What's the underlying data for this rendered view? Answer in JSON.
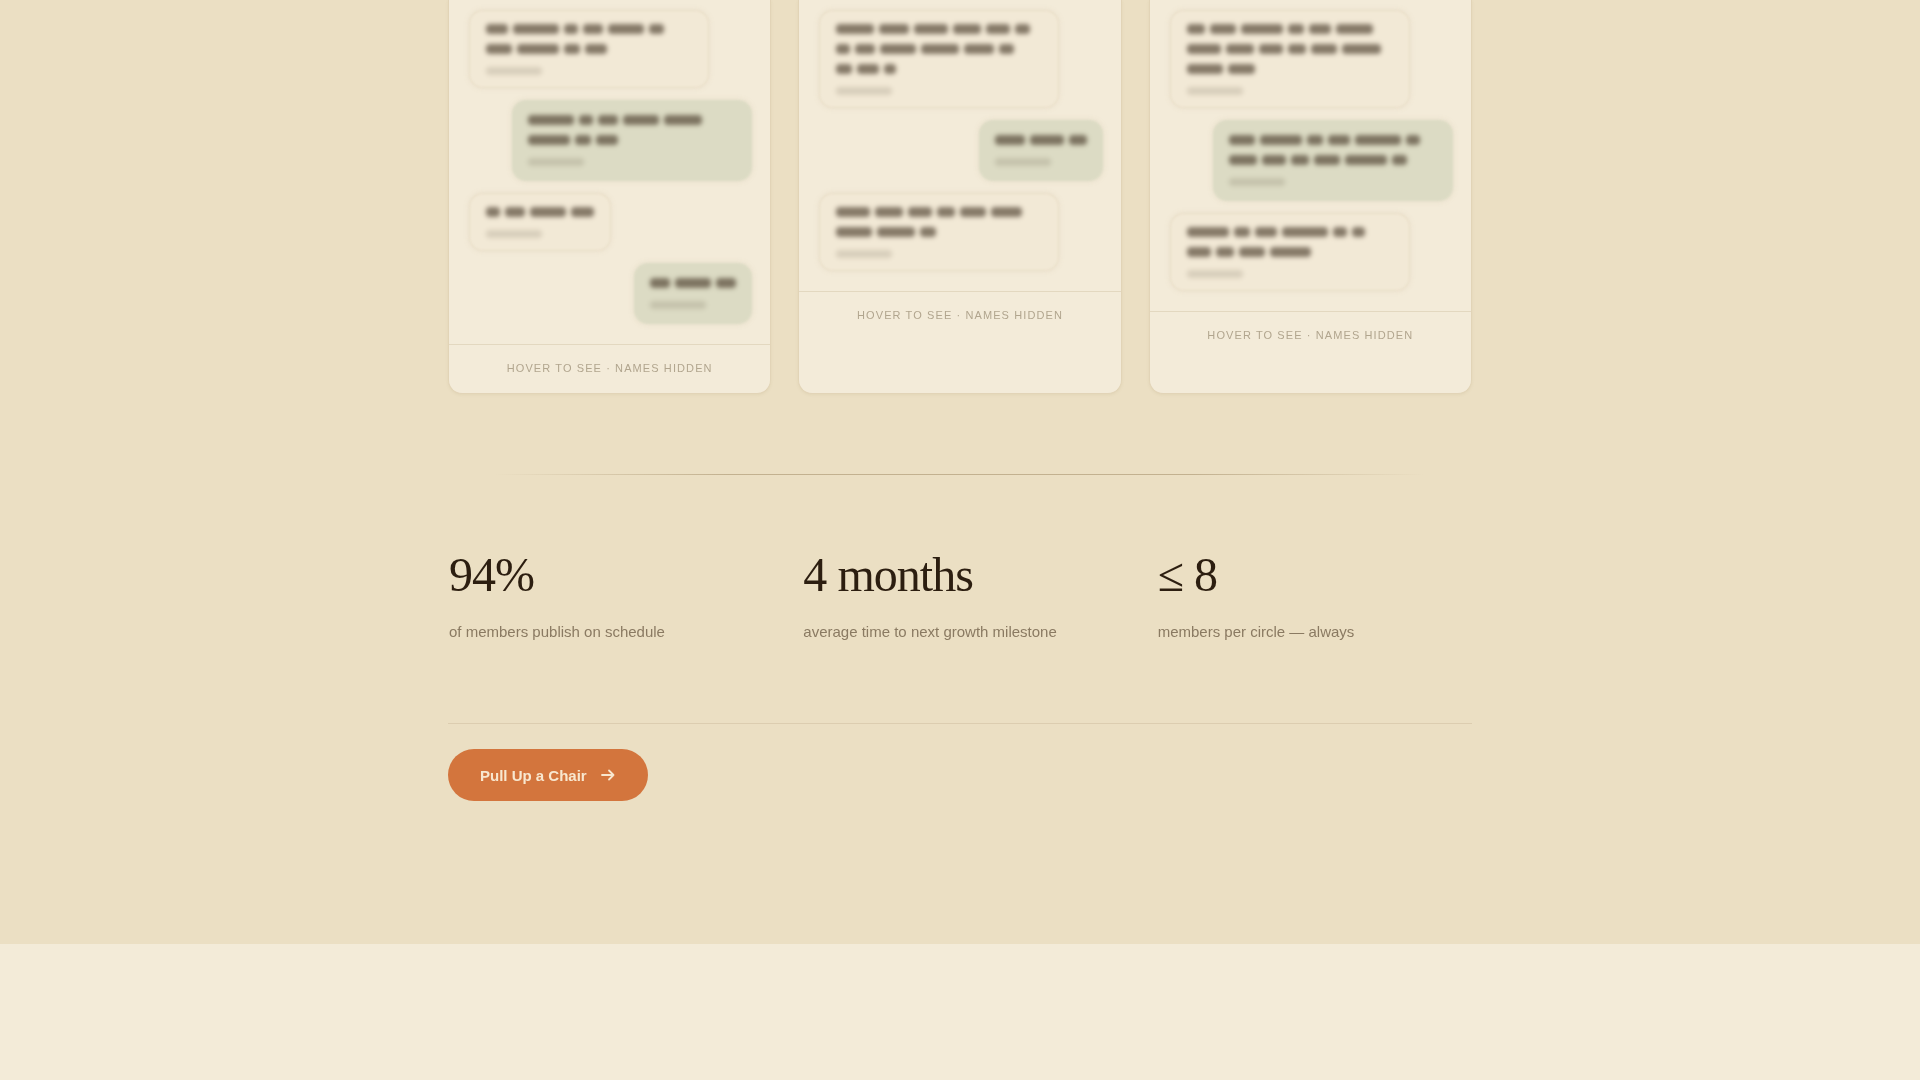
{
  "chat_cards": [
    {
      "messages": [
        {
          "kind": "received",
          "lines": [
            {
              "kind": "full"
            },
            {
              "kind": "partial"
            }
          ]
        },
        {
          "kind": "sent",
          "lines": [
            {
              "kind": "full"
            },
            {
              "kind": "partial"
            }
          ]
        },
        {
          "kind": "received",
          "lines": [
            {
              "kind": "partial"
            }
          ]
        },
        {
          "kind": "sent",
          "lines": [
            {
              "kind": "partial"
            }
          ]
        }
      ],
      "footer": "HOVER TO SEE · NAMES HIDDEN"
    },
    {
      "messages": [
        {
          "kind": "received",
          "lines": [
            {
              "kind": "full"
            },
            {
              "kind": "full"
            },
            {
              "kind": "partial"
            }
          ]
        },
        {
          "kind": "sent",
          "lines": [
            {
              "kind": "partial"
            }
          ]
        },
        {
          "kind": "received",
          "lines": [
            {
              "kind": "full"
            },
            {
              "kind": "partial"
            }
          ]
        }
      ],
      "footer": "HOVER TO SEE · NAMES HIDDEN"
    },
    {
      "messages": [
        {
          "kind": "received",
          "lines": [
            {
              "kind": "full"
            },
            {
              "kind": "full"
            },
            {
              "kind": "partial"
            }
          ]
        },
        {
          "kind": "sent",
          "lines": [
            {
              "kind": "full"
            },
            {
              "kind": "full"
            }
          ]
        },
        {
          "kind": "received",
          "lines": [
            {
              "kind": "full"
            },
            {
              "kind": "partial"
            }
          ]
        }
      ],
      "footer": "HOVER TO SEE · NAMES HIDDEN"
    }
  ],
  "stats": [
    {
      "value": "94%",
      "label": "of members publish on schedule"
    },
    {
      "value": "4 months",
      "label": "average time to next growth milestone"
    },
    {
      "value": "≤ 8",
      "label": "members per circle — always"
    }
  ],
  "cta_button": {
    "label": "Pull Up a Chair"
  }
}
